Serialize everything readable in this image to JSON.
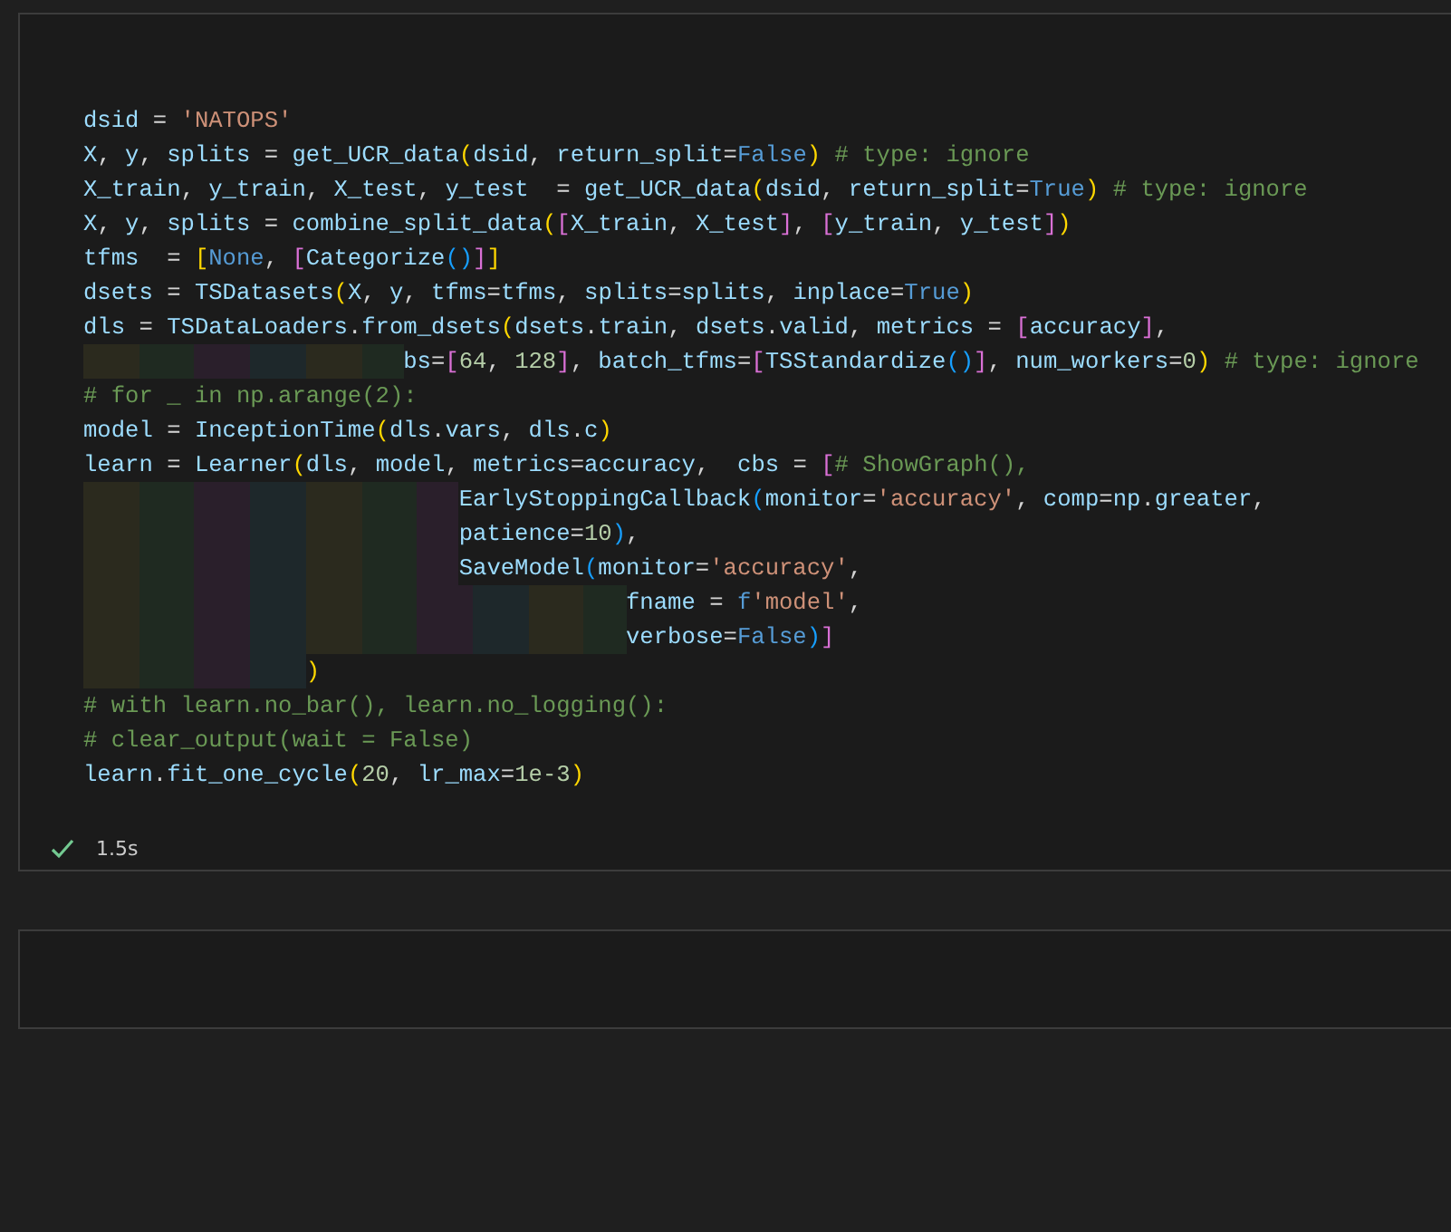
{
  "cells": [
    {
      "kind": "code",
      "lines": [
        [
          {
            "kind": "v",
            "text": "dsid"
          },
          {
            "kind": "p",
            "text": " = "
          },
          {
            "kind": "s",
            "text": "'NATOPS'"
          }
        ],
        [
          {
            "kind": "v",
            "text": "X"
          },
          {
            "kind": "p",
            "text": ", "
          },
          {
            "kind": "v",
            "text": "y"
          },
          {
            "kind": "p",
            "text": ", "
          },
          {
            "kind": "v",
            "text": "splits"
          },
          {
            "kind": "p",
            "text": " = "
          },
          {
            "kind": "v",
            "text": "get_UCR_data"
          },
          {
            "kind": "b1",
            "text": "("
          },
          {
            "kind": "v",
            "text": "dsid"
          },
          {
            "kind": "p",
            "text": ", "
          },
          {
            "kind": "v",
            "text": "return_split"
          },
          {
            "kind": "p",
            "text": "="
          },
          {
            "kind": "k",
            "text": "False"
          },
          {
            "kind": "b1",
            "text": ")"
          },
          {
            "kind": "c",
            "text": " # type: ignore"
          }
        ],
        [
          {
            "kind": "v",
            "text": "X_train"
          },
          {
            "kind": "p",
            "text": ", "
          },
          {
            "kind": "v",
            "text": "y_train"
          },
          {
            "kind": "p",
            "text": ", "
          },
          {
            "kind": "v",
            "text": "X_test"
          },
          {
            "kind": "p",
            "text": ", "
          },
          {
            "kind": "v",
            "text": "y_test"
          },
          {
            "kind": "p",
            "text": "  = "
          },
          {
            "kind": "v",
            "text": "get_UCR_data"
          },
          {
            "kind": "b1",
            "text": "("
          },
          {
            "kind": "v",
            "text": "dsid"
          },
          {
            "kind": "p",
            "text": ", "
          },
          {
            "kind": "v",
            "text": "return_split"
          },
          {
            "kind": "p",
            "text": "="
          },
          {
            "kind": "k",
            "text": "True"
          },
          {
            "kind": "b1",
            "text": ")"
          },
          {
            "kind": "c",
            "text": " # type: ignore"
          }
        ],
        [
          {
            "kind": "v",
            "text": "X"
          },
          {
            "kind": "p",
            "text": ", "
          },
          {
            "kind": "v",
            "text": "y"
          },
          {
            "kind": "p",
            "text": ", "
          },
          {
            "kind": "v",
            "text": "splits"
          },
          {
            "kind": "p",
            "text": " = "
          },
          {
            "kind": "v",
            "text": "combine_split_data"
          },
          {
            "kind": "b1",
            "text": "("
          },
          {
            "kind": "b2",
            "text": "["
          },
          {
            "kind": "v",
            "text": "X_train"
          },
          {
            "kind": "p",
            "text": ", "
          },
          {
            "kind": "v",
            "text": "X_test"
          },
          {
            "kind": "b2",
            "text": "]"
          },
          {
            "kind": "p",
            "text": ", "
          },
          {
            "kind": "b2",
            "text": "["
          },
          {
            "kind": "v",
            "text": "y_train"
          },
          {
            "kind": "p",
            "text": ", "
          },
          {
            "kind": "v",
            "text": "y_test"
          },
          {
            "kind": "b2",
            "text": "]"
          },
          {
            "kind": "b1",
            "text": ")"
          }
        ],
        [
          {
            "kind": "v",
            "text": "tfms"
          },
          {
            "kind": "p",
            "text": "  = "
          },
          {
            "kind": "b1",
            "text": "["
          },
          {
            "kind": "k",
            "text": "None"
          },
          {
            "kind": "p",
            "text": ", "
          },
          {
            "kind": "b2",
            "text": "["
          },
          {
            "kind": "v",
            "text": "Categorize"
          },
          {
            "kind": "b3",
            "text": "()"
          },
          {
            "kind": "b2",
            "text": "]"
          },
          {
            "kind": "b1",
            "text": "]"
          }
        ],
        [
          {
            "kind": "v",
            "text": "dsets"
          },
          {
            "kind": "p",
            "text": " = "
          },
          {
            "kind": "v",
            "text": "TSDatasets"
          },
          {
            "kind": "b1",
            "text": "("
          },
          {
            "kind": "v",
            "text": "X"
          },
          {
            "kind": "p",
            "text": ", "
          },
          {
            "kind": "v",
            "text": "y"
          },
          {
            "kind": "p",
            "text": ", "
          },
          {
            "kind": "v",
            "text": "tfms"
          },
          {
            "kind": "p",
            "text": "="
          },
          {
            "kind": "v",
            "text": "tfms"
          },
          {
            "kind": "p",
            "text": ", "
          },
          {
            "kind": "v",
            "text": "splits"
          },
          {
            "kind": "p",
            "text": "="
          },
          {
            "kind": "v",
            "text": "splits"
          },
          {
            "kind": "p",
            "text": ", "
          },
          {
            "kind": "v",
            "text": "inplace"
          },
          {
            "kind": "p",
            "text": "="
          },
          {
            "kind": "k",
            "text": "True"
          },
          {
            "kind": "b1",
            "text": ")"
          }
        ],
        [
          {
            "kind": "v",
            "text": "dls"
          },
          {
            "kind": "p",
            "text": " = "
          },
          {
            "kind": "v",
            "text": "TSDataLoaders"
          },
          {
            "kind": "p",
            "text": "."
          },
          {
            "kind": "v",
            "text": "from_dsets"
          },
          {
            "kind": "b1",
            "text": "("
          },
          {
            "kind": "v",
            "text": "dsets"
          },
          {
            "kind": "p",
            "text": "."
          },
          {
            "kind": "v",
            "text": "train"
          },
          {
            "kind": "p",
            "text": ", "
          },
          {
            "kind": "v",
            "text": "dsets"
          },
          {
            "kind": "p",
            "text": "."
          },
          {
            "kind": "v",
            "text": "valid"
          },
          {
            "kind": "p",
            "text": ", "
          },
          {
            "kind": "v",
            "text": "metrics"
          },
          {
            "kind": "p",
            "text": " = "
          },
          {
            "kind": "b2",
            "text": "["
          },
          {
            "kind": "v",
            "text": "accuracy"
          },
          {
            "kind": "b2",
            "text": "]"
          },
          {
            "kind": "p",
            "text": ","
          }
        ],
        [
          {
            "kind": "v",
            "text": "                       bs"
          },
          {
            "kind": "p",
            "text": "="
          },
          {
            "kind": "b2",
            "text": "["
          },
          {
            "kind": "n",
            "text": "64"
          },
          {
            "kind": "p",
            "text": ", "
          },
          {
            "kind": "n",
            "text": "128"
          },
          {
            "kind": "b2",
            "text": "]"
          },
          {
            "kind": "p",
            "text": ", "
          },
          {
            "kind": "v",
            "text": "batch_tfms"
          },
          {
            "kind": "p",
            "text": "="
          },
          {
            "kind": "b2",
            "text": "["
          },
          {
            "kind": "v",
            "text": "TSStandardize"
          },
          {
            "kind": "b3",
            "text": "()"
          },
          {
            "kind": "b2",
            "text": "]"
          },
          {
            "kind": "p",
            "text": ", "
          },
          {
            "kind": "v",
            "text": "num_workers"
          },
          {
            "kind": "p",
            "text": "="
          },
          {
            "kind": "n",
            "text": "0"
          },
          {
            "kind": "b1",
            "text": ")"
          },
          {
            "kind": "c",
            "text": " # type: ignore"
          }
        ],
        [
          {
            "kind": "c",
            "text": "# for _ in np.arange(2):"
          }
        ],
        [
          {
            "kind": "v",
            "text": "model"
          },
          {
            "kind": "p",
            "text": " = "
          },
          {
            "kind": "v",
            "text": "InceptionTime"
          },
          {
            "kind": "b1",
            "text": "("
          },
          {
            "kind": "v",
            "text": "dls"
          },
          {
            "kind": "p",
            "text": "."
          },
          {
            "kind": "v",
            "text": "vars"
          },
          {
            "kind": "p",
            "text": ", "
          },
          {
            "kind": "v",
            "text": "dls"
          },
          {
            "kind": "p",
            "text": "."
          },
          {
            "kind": "v",
            "text": "c"
          },
          {
            "kind": "b1",
            "text": ")"
          }
        ],
        [
          {
            "kind": "v",
            "text": "learn"
          },
          {
            "kind": "p",
            "text": " = "
          },
          {
            "kind": "v",
            "text": "Learner"
          },
          {
            "kind": "b1",
            "text": "("
          },
          {
            "kind": "v",
            "text": "dls"
          },
          {
            "kind": "p",
            "text": ", "
          },
          {
            "kind": "v",
            "text": "model"
          },
          {
            "kind": "p",
            "text": ", "
          },
          {
            "kind": "v",
            "text": "metrics"
          },
          {
            "kind": "p",
            "text": "="
          },
          {
            "kind": "v",
            "text": "accuracy"
          },
          {
            "kind": "p",
            "text": ",  "
          },
          {
            "kind": "v",
            "text": "cbs"
          },
          {
            "kind": "p",
            "text": " = "
          },
          {
            "kind": "b2",
            "text": "["
          },
          {
            "kind": "c",
            "text": "# ShowGraph(),"
          }
        ],
        [
          {
            "kind": "v",
            "text": "                           EarlyStoppingCallback"
          },
          {
            "kind": "b3",
            "text": "("
          },
          {
            "kind": "v",
            "text": "monitor"
          },
          {
            "kind": "p",
            "text": "="
          },
          {
            "kind": "s",
            "text": "'accuracy'"
          },
          {
            "kind": "p",
            "text": ", "
          },
          {
            "kind": "v",
            "text": "comp"
          },
          {
            "kind": "p",
            "text": "="
          },
          {
            "kind": "v",
            "text": "np"
          },
          {
            "kind": "p",
            "text": "."
          },
          {
            "kind": "v",
            "text": "greater"
          },
          {
            "kind": "p",
            "text": ","
          }
        ],
        [
          {
            "kind": "v",
            "text": "                           patience"
          },
          {
            "kind": "p",
            "text": "="
          },
          {
            "kind": "n",
            "text": "10"
          },
          {
            "kind": "b3",
            "text": ")"
          },
          {
            "kind": "p",
            "text": ","
          }
        ],
        [
          {
            "kind": "v",
            "text": "                           SaveModel"
          },
          {
            "kind": "b3",
            "text": "("
          },
          {
            "kind": "v",
            "text": "monitor"
          },
          {
            "kind": "p",
            "text": "="
          },
          {
            "kind": "s",
            "text": "'accuracy'"
          },
          {
            "kind": "p",
            "text": ","
          }
        ],
        [
          {
            "kind": "v",
            "text": "                                       fname"
          },
          {
            "kind": "p",
            "text": " = "
          },
          {
            "kind": "k",
            "text": "f"
          },
          {
            "kind": "s",
            "text": "'model'"
          },
          {
            "kind": "p",
            "text": ","
          }
        ],
        [
          {
            "kind": "v",
            "text": "                                       verbose"
          },
          {
            "kind": "p",
            "text": "="
          },
          {
            "kind": "k",
            "text": "False"
          },
          {
            "kind": "b3",
            "text": ")"
          },
          {
            "kind": "b2",
            "text": "]"
          }
        ],
        [
          {
            "kind": "b1",
            "text": "                )"
          }
        ],
        [
          {
            "kind": "c",
            "text": "# with learn.no_bar(), learn.no_logging():"
          }
        ],
        [
          {
            "kind": "c",
            "text": "# clear_output(wait = False)"
          }
        ],
        [
          {
            "kind": "v",
            "text": "learn"
          },
          {
            "kind": "p",
            "text": "."
          },
          {
            "kind": "v",
            "text": "fit_one_cycle"
          },
          {
            "kind": "b1",
            "text": "("
          },
          {
            "kind": "n",
            "text": "20"
          },
          {
            "kind": "p",
            "text": ", "
          },
          {
            "kind": "v",
            "text": "lr_max"
          },
          {
            "kind": "p",
            "text": "="
          },
          {
            "kind": "n",
            "text": "1e-3"
          },
          {
            "kind": "b1",
            "text": ")"
          }
        ]
      ],
      "status": {
        "success": true,
        "duration": "1.5s"
      }
    },
    {
      "kind": "empty"
    }
  ]
}
